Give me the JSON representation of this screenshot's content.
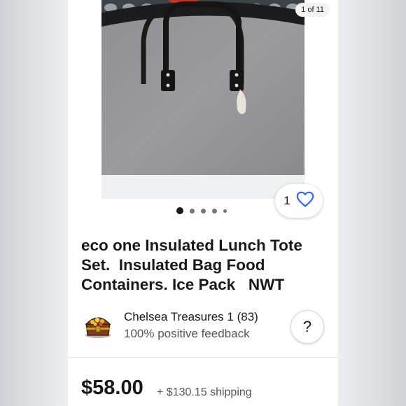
{
  "gallery": {
    "counter": "1 of 11",
    "image_alt": "Gray insulated lunch tote with black handles",
    "like_count": "1",
    "dots_total": 5,
    "dots_active": 1
  },
  "listing": {
    "title": "eco one Insulated Lunch Tote Set.  Insulated Bag Food Containers. Ice Pack   NWT"
  },
  "seller": {
    "name": "Chelsea Treasures 1 (83)",
    "feedback": "100% positive feedback",
    "help_label": "?"
  },
  "pricing": {
    "price": "$58.00",
    "shipping": "+ $130.15 shipping"
  },
  "colors": {
    "accent": "#3665f3",
    "text": "#191919",
    "secondary_text": "#555555"
  },
  "icons": {
    "like": "heart-outline-icon",
    "seller": "treasure-chest-icon"
  }
}
